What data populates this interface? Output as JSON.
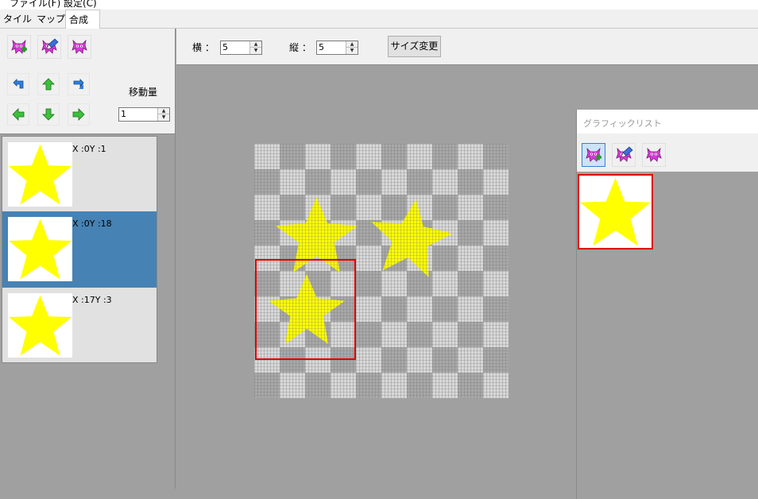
{
  "menu": [
    {
      "label": "ファイル(F)"
    },
    {
      "label": "設定(C)"
    }
  ],
  "tabs": [
    {
      "label": "タイル",
      "selected": false
    },
    {
      "label": "マップ",
      "selected": false
    },
    {
      "label": "合成",
      "selected": true
    }
  ],
  "left_panel": {
    "tool_icons": [
      "add-graphic-icon",
      "edit-graphic-icon",
      "delete-graphic-icon"
    ],
    "arrows": [
      "rotate-left-icon",
      "arrow-up-icon",
      "rotate-right-icon",
      "arrow-left-icon",
      "arrow-down-icon",
      "arrow-right-icon"
    ],
    "move_amount_label": "移動量",
    "move_amount_value": "1"
  },
  "layers": [
    {
      "label": "X :0Y :1",
      "selected": false
    },
    {
      "label": "X :0Y :18",
      "selected": true
    },
    {
      "label": "X :17Y :3",
      "selected": false
    }
  ],
  "toolbar": {
    "width_label": "横 ：",
    "width_value": "5",
    "height_label": "縦 ：",
    "height_value": "5",
    "resize_button": "サイズ変更"
  },
  "graphic_list": {
    "title": "グラフィックリスト",
    "tool_icons": [
      "add-graphic-icon",
      "edit-graphic-icon",
      "delete-graphic-icon"
    ]
  },
  "colors": {
    "accent_selected": "#4682b4",
    "star": "#ffff00",
    "selection_border": "#e00000",
    "checker_light": "#d8d8d8",
    "checker_dark": "#a8a8a8"
  }
}
